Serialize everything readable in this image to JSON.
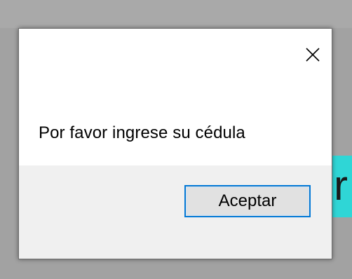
{
  "dialog": {
    "message": "Por favor ingrese su cédula",
    "ok_label": "Aceptar",
    "close_icon": "close-icon"
  },
  "background": {
    "partial_glyph": "r"
  },
  "colors": {
    "accent": "#0078d7",
    "backdrop_accent": "#2fd6d6",
    "footer": "#f0f0f0"
  }
}
